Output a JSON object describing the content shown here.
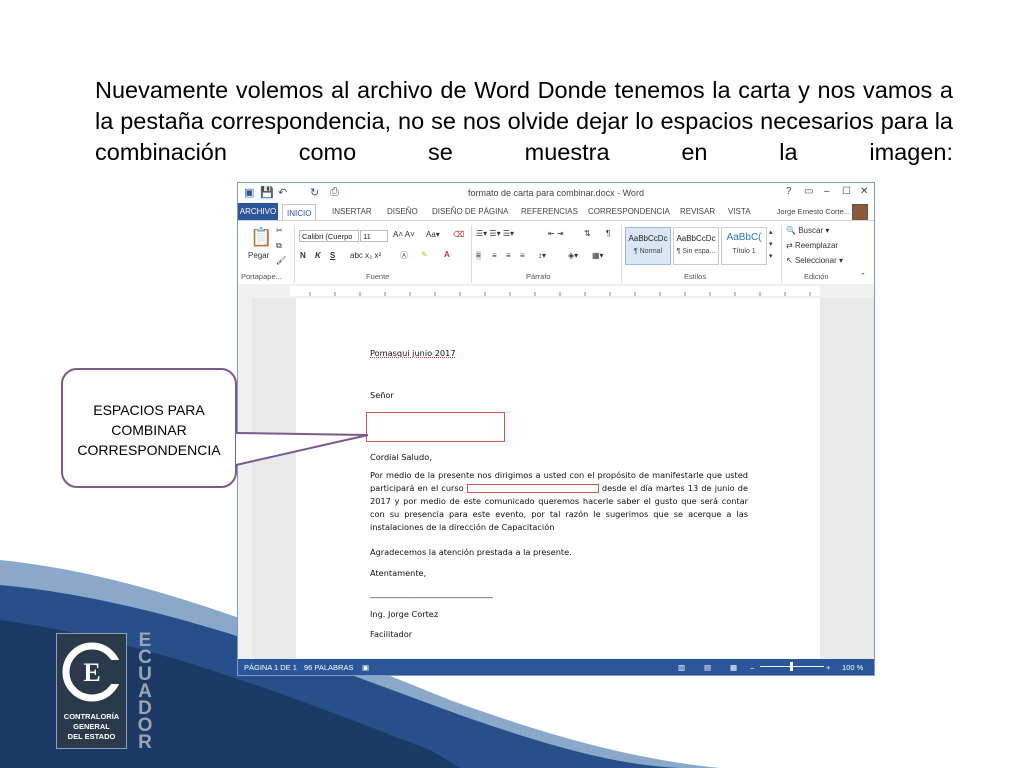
{
  "slide": {
    "heading": "Nuevamente volemos al archivo de Word Donde tenemos la carta y nos vamos a la pestaña correspondencia, no se nos olvide dejar lo espacios necesarios para la combinación como se muestra en la imagen:",
    "callout_lines": [
      "ESPACIOS PARA",
      "COMBINAR",
      "CORRESPONDENCIA"
    ]
  },
  "word": {
    "window_title": "formato de carta para combinar.docx - Word",
    "window_controls": [
      "?",
      "▭",
      "–",
      "☐",
      "✕"
    ],
    "tabs": [
      "ARCHIVO",
      "INICIO",
      "INSERTAR",
      "DISEÑO",
      "DISEÑO DE PÁGINA",
      "REFERENCIAS",
      "CORRESPONDENCIA",
      "REVISAR",
      "VISTA"
    ],
    "active_tab": "INICIO",
    "user_name": "Jorge Ernesto Corte...",
    "ribbon": {
      "paste_label": "Pegar",
      "clipboard_group": "Portapape...",
      "font_name": "Calibri (Cuerpo",
      "font_size": "11",
      "font_group": "Fuente",
      "paragraph_group": "Párrafo",
      "styles_group": "Estilos",
      "editing_group": "Edición",
      "styles": [
        {
          "sample": "AaBbCcDc",
          "name": "¶ Normal"
        },
        {
          "sample": "AaBbCcDc",
          "name": "¶ Sin espa..."
        },
        {
          "sample": "AaBbC(",
          "name": "Título 1"
        }
      ],
      "find_label": "Buscar",
      "replace_label": "Reemplazar",
      "select_label": "Seleccionar"
    },
    "document": {
      "date_line": "Pomasqui  junio 2017",
      "salutation_to": "Señor",
      "greeting": "Cordial Saludo,",
      "body_start": "Por medio de la presente nos dirigimos a usted con el propósito de manifestarle que usted participará en el curso",
      "body_end": "desde el día martes 13 de junio de 2017 y por medio de este comunicado queremos hacerle saber el gusto que será contar con su presencia para este evento, por tal razón le sugerimos que se acerque  a las instalaciones de la dirección de Capacitación",
      "thanks": "Agradecemos la atención prestada a la presente.",
      "closing": "Atentamente,",
      "signature_line": "______________________________",
      "signer": "Ing. Jorge Cortez",
      "signer_title": "Facilitador"
    },
    "status": {
      "page": "PÁGINA 1 DE 1",
      "words": "96 PALABRAS",
      "zoom": "100 %"
    }
  },
  "logo": {
    "name_lines": [
      "CONTRALORÍA",
      "GENERAL",
      "DEL ESTADO"
    ],
    "country_letters": [
      "E",
      "C",
      "U",
      "A",
      "D",
      "O",
      "R"
    ]
  },
  "colors": {
    "word_blue": "#2b579a",
    "callout_border": "#7b5a8e",
    "highlight_box": "#d9534f",
    "wave_dark": "#1f3f6e"
  }
}
